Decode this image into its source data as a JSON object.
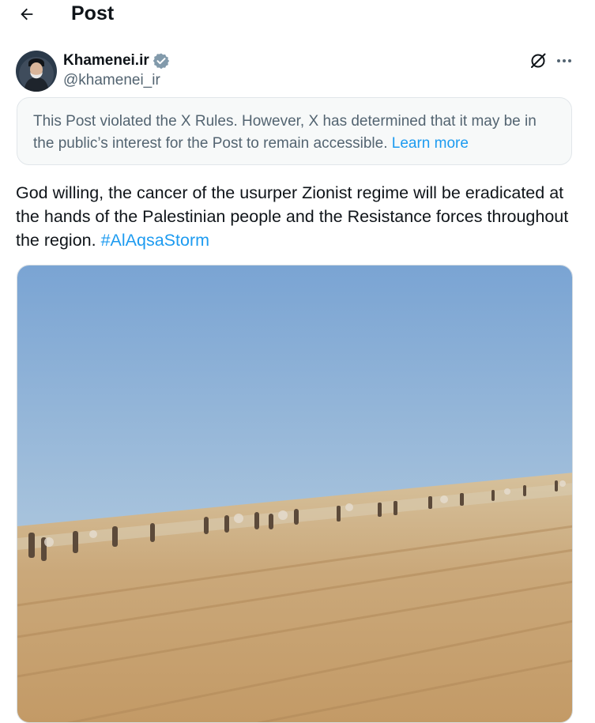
{
  "header": {
    "title": "Post"
  },
  "post": {
    "author": {
      "name": "Khamenei.ir",
      "handle": "@khamenei_ir"
    },
    "notice": {
      "text": "This Post violated the X Rules. However, X has determined that it may be in the public’s interest for the Post to remain accessible.",
      "link_label": "Learn more"
    },
    "text": "God willing, the cancer of the usurper Zionist regime will be eradicated at the hands of the Palestinian people and the Resistance forces throughout the region.",
    "hashtag": "#AlAqsaStorm"
  },
  "colors": {
    "accent": "#1d9bf0",
    "secondary_text": "#536471",
    "notice_bg": "#f7f9f9"
  },
  "icons": {
    "back": "arrow-left-icon",
    "verified": "verified-badge-icon",
    "grok": "grok-icon",
    "more": "more-horizontal-icon"
  }
}
